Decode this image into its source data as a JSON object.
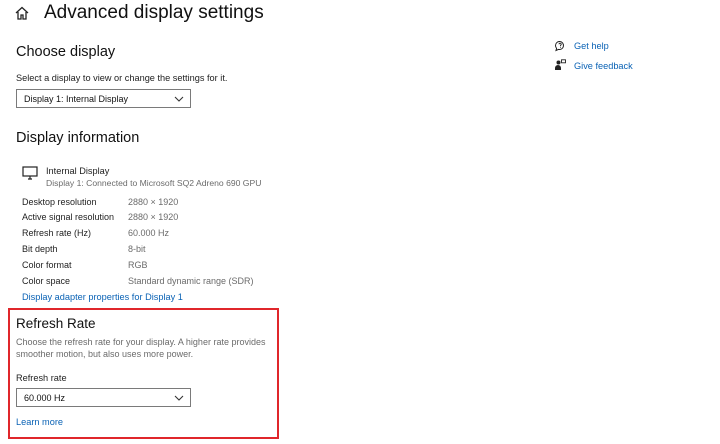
{
  "header": {
    "title": "Advanced display settings"
  },
  "choose_display": {
    "heading": "Choose display",
    "description": "Select a display to view or change the settings for it.",
    "selected": "Display 1: Internal Display"
  },
  "display_info": {
    "heading": "Display information",
    "monitor_name": "Internal Display",
    "monitor_detail": "Display 1: Connected to Microsoft SQ2 Adreno 690 GPU",
    "rows": [
      {
        "label": "Desktop resolution",
        "value": "2880 × 1920"
      },
      {
        "label": "Active signal resolution",
        "value": "2880 × 1920"
      },
      {
        "label": "Refresh rate (Hz)",
        "value": "60.000 Hz"
      },
      {
        "label": "Bit depth",
        "value": "8-bit"
      },
      {
        "label": "Color format",
        "value": "RGB"
      },
      {
        "label": "Color space",
        "value": "Standard dynamic range (SDR)"
      }
    ],
    "adapter_link": "Display adapter properties for Display 1"
  },
  "refresh_rate": {
    "heading": "Refresh Rate",
    "description_line1": "Choose the refresh rate for your display. A higher rate provides",
    "description_line2": "smoother motion, but also uses more power.",
    "field_label": "Refresh rate",
    "selected": "60.000 Hz",
    "learn_more": "Learn more"
  },
  "side_links": {
    "get_help": "Get help",
    "give_feedback": "Give feedback"
  },
  "colors": {
    "link": "#0a62b5",
    "highlight_border": "#e0262b"
  },
  "icons": {
    "home": "home-icon",
    "monitor": "monitor-icon",
    "chevron": "chevron-down-icon",
    "help": "help-icon",
    "feedback": "feedback-icon"
  }
}
